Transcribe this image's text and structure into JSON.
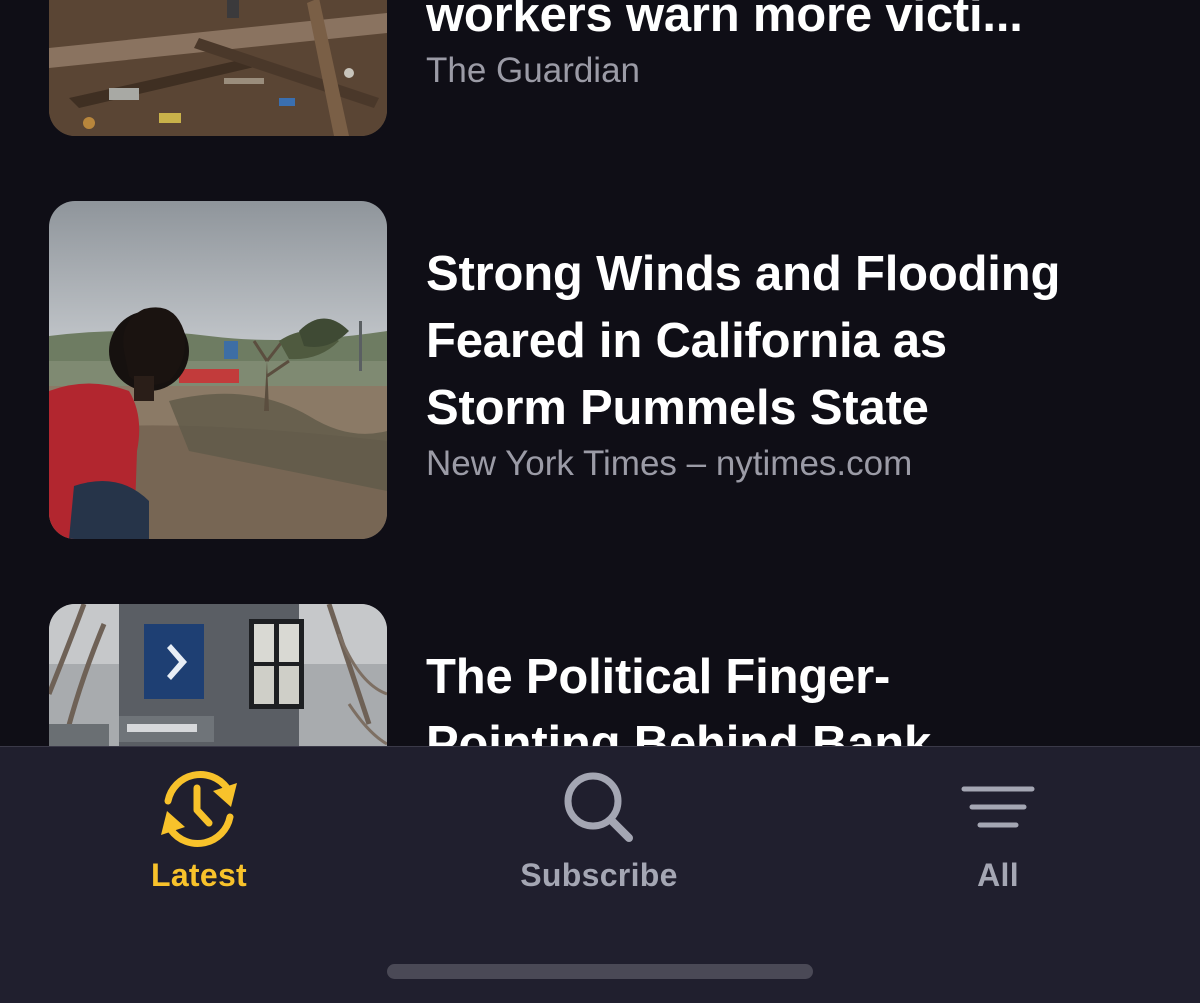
{
  "feed": {
    "articles": [
      {
        "headline": "workers warn more victi...",
        "source": "The Guardian"
      },
      {
        "headline_lines": [
          "Strong Winds and Flooding",
          "Feared in California as",
          "Storm Pummels State"
        ],
        "source": "New York Times – nytimes.com"
      },
      {
        "headline_lines": [
          "The Political Finger-",
          "Pointing Behind Bank"
        ],
        "source": ""
      }
    ]
  },
  "tabbar": {
    "tabs": [
      {
        "label": "Latest",
        "icon": "clock-refresh-icon",
        "active": true
      },
      {
        "label": "Subscribe",
        "icon": "search-icon",
        "active": false
      },
      {
        "label": "All",
        "icon": "list-lines-icon",
        "active": false
      }
    ]
  },
  "colors": {
    "background": "#0f0e16",
    "tabbar_background": "#201f2e",
    "accent": "#f8c22b",
    "inactive": "#a4a6b3",
    "headline": "#ffffff",
    "source": "#9b9ba6"
  }
}
